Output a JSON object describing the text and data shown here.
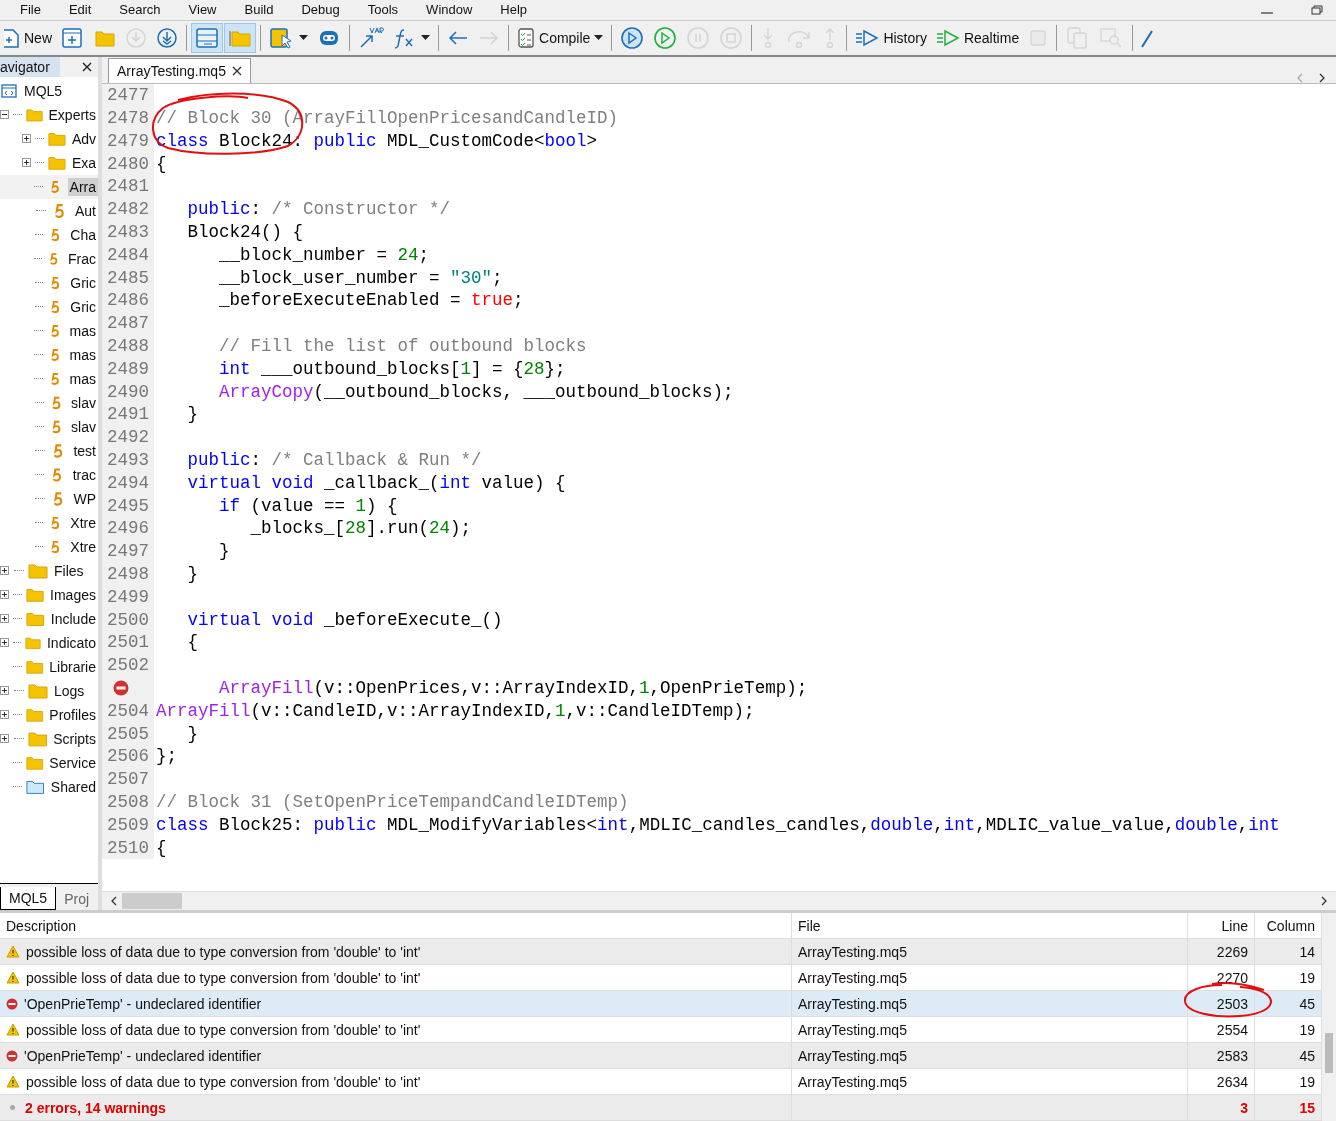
{
  "menu": [
    "File",
    "Edit",
    "Search",
    "View",
    "Build",
    "Debug",
    "Tools",
    "Window",
    "Help"
  ],
  "toolbar": [
    {
      "kind": "new",
      "label": "New",
      "disabled": false,
      "pressed": false
    },
    {
      "kind": "new-file",
      "disabled": false,
      "pressed": false
    },
    {
      "kind": "folder",
      "disabled": false,
      "pressed": false
    },
    {
      "kind": "download",
      "disabled": true,
      "pressed": false
    },
    {
      "kind": "download",
      "disabled": false,
      "pressed": false
    },
    {
      "kind": "separator"
    },
    {
      "kind": "layout",
      "disabled": false,
      "pressed": true
    },
    {
      "kind": "folder-panel",
      "disabled": false,
      "pressed": true
    },
    {
      "kind": "separator"
    },
    {
      "kind": "clipboard",
      "disabled": false,
      "pressed": false,
      "dropdown": true
    },
    {
      "kind": "robot",
      "disabled": false,
      "pressed": false
    },
    {
      "kind": "separator"
    },
    {
      "kind": "var",
      "disabled": false,
      "pressed": false
    },
    {
      "kind": "function",
      "disabled": false,
      "pressed": false,
      "dropdown": true
    },
    {
      "kind": "separator"
    },
    {
      "kind": "back",
      "disabled": false,
      "pressed": false
    },
    {
      "kind": "forward",
      "disabled": true,
      "pressed": false
    },
    {
      "kind": "separator"
    },
    {
      "kind": "compile",
      "label": "Compile",
      "disabled": false,
      "pressed": false,
      "dropdown": true
    },
    {
      "kind": "separator"
    },
    {
      "kind": "restart",
      "disabled": false,
      "pressed": false
    },
    {
      "kind": "play",
      "disabled": false,
      "pressed": false
    },
    {
      "kind": "pause",
      "disabled": true,
      "pressed": false
    },
    {
      "kind": "stop",
      "disabled": true,
      "pressed": false
    },
    {
      "kind": "separator"
    },
    {
      "kind": "step-into",
      "disabled": true,
      "pressed": false
    },
    {
      "kind": "step-over",
      "disabled": true,
      "pressed": false
    },
    {
      "kind": "step-out",
      "disabled": true,
      "pressed": false
    },
    {
      "kind": "separator"
    },
    {
      "kind": "history",
      "label": "History",
      "disabled": false,
      "pressed": false
    },
    {
      "kind": "realtime",
      "label": "Realtime",
      "disabled": false,
      "pressed": false
    },
    {
      "kind": "square",
      "disabled": true,
      "pressed": false
    },
    {
      "kind": "separator"
    },
    {
      "kind": "copy",
      "disabled": true,
      "pressed": false
    },
    {
      "kind": "search-doc",
      "disabled": true,
      "pressed": false
    },
    {
      "kind": "separator"
    },
    {
      "kind": "pen"
    }
  ],
  "navigator": {
    "title": "avigator",
    "tree": [
      {
        "label": "MQL5",
        "kind": "root",
        "selected": false,
        "children": [
          {
            "label": "Experts",
            "kind": "folder",
            "expanded": true,
            "selected": false,
            "children": [
              {
                "label": "Adv",
                "kind": "folder",
                "expanded": false,
                "selected": false
              },
              {
                "label": "Exa",
                "kind": "folder",
                "expanded": false,
                "selected": false
              },
              {
                "label": "Arra",
                "kind": "file",
                "selected": true
              },
              {
                "label": "Aut",
                "kind": "file",
                "selected": false
              },
              {
                "label": "Cha",
                "kind": "file",
                "selected": false
              },
              {
                "label": "Frac",
                "kind": "file",
                "selected": false
              },
              {
                "label": "Gric",
                "kind": "file",
                "selected": false
              },
              {
                "label": "Gric",
                "kind": "file",
                "selected": false
              },
              {
                "label": "mas",
                "kind": "file",
                "selected": false
              },
              {
                "label": "mas",
                "kind": "file",
                "selected": false
              },
              {
                "label": "mas",
                "kind": "file",
                "selected": false
              },
              {
                "label": "slav",
                "kind": "file",
                "selected": false
              },
              {
                "label": "slav",
                "kind": "file",
                "selected": false
              },
              {
                "label": "test",
                "kind": "file",
                "selected": false
              },
              {
                "label": "trac",
                "kind": "file",
                "selected": false
              },
              {
                "label": "WP",
                "kind": "file",
                "selected": false
              },
              {
                "label": "Xtre",
                "kind": "file",
                "selected": false
              },
              {
                "label": "Xtre",
                "kind": "file",
                "selected": false
              }
            ]
          },
          {
            "label": "Files",
            "kind": "folder",
            "expanded": false,
            "selected": false
          },
          {
            "label": "Images",
            "kind": "folder",
            "expanded": false,
            "selected": false
          },
          {
            "label": "Include",
            "kind": "folder",
            "expanded": false,
            "selected": false
          },
          {
            "label": "Indicato",
            "kind": "folder",
            "expanded": false,
            "selected": false
          },
          {
            "label": "Librarie",
            "kind": "folder",
            "selected": false
          },
          {
            "label": "Logs",
            "kind": "folder",
            "expanded": false,
            "selected": false
          },
          {
            "label": "Profiles",
            "kind": "folder",
            "expanded": false,
            "selected": false
          },
          {
            "label": "Scripts",
            "kind": "folder",
            "expanded": false,
            "selected": false
          },
          {
            "label": "Service",
            "kind": "folder",
            "selected": false
          },
          {
            "label": "Shared",
            "kind": "shared",
            "selected": false
          }
        ]
      }
    ],
    "tabs": [
      {
        "label": "MQL5",
        "selected": true
      },
      {
        "label": "Proj",
        "selected": false
      }
    ]
  },
  "editor": {
    "tab": "ArrayTesting.mq5",
    "lines": [
      {
        "kind": "code",
        "number": "2477"
      },
      {
        "number": "2478",
        "tokens": [
          {
            "kind": "comment",
            "text": "// Block 30 (ArrayFillOpenPricesandCandleID)"
          }
        ]
      },
      {
        "number": "2479",
        "tokens": [
          {
            "kind": "keyword",
            "text": "class"
          },
          {
            "kind": "plain",
            "text": " Block24: "
          },
          {
            "kind": "keyword",
            "text": "public"
          },
          {
            "kind": "plain",
            "text": " MDL_CustomCode<"
          },
          {
            "kind": "keyword",
            "text": "bool"
          },
          {
            "kind": "plain",
            "text": ">"
          }
        ]
      },
      {
        "number": "2480",
        "tokens": [
          {
            "kind": "plain",
            "text": "{"
          }
        ]
      },
      {
        "kind": "code",
        "number": "2481"
      },
      {
        "number": "2482",
        "tokens": [
          {
            "kind": "keyword",
            "text": "   public"
          },
          {
            "kind": "plain",
            "text": ": "
          },
          {
            "kind": "comment",
            "text": "/* Constructor */"
          }
        ]
      },
      {
        "number": "2483",
        "tokens": [
          {
            "kind": "plain",
            "text": "   Block24() {"
          }
        ]
      },
      {
        "number": "2484",
        "tokens": [
          {
            "kind": "plain",
            "text": "      __block_number = "
          },
          {
            "kind": "number",
            "text": "24"
          },
          {
            "kind": "plain",
            "text": ";"
          }
        ]
      },
      {
        "number": "2485",
        "tokens": [
          {
            "kind": "plain",
            "text": "      __block_user_number = "
          },
          {
            "kind": "string",
            "text": "\"30\""
          },
          {
            "kind": "plain",
            "text": ";"
          }
        ]
      },
      {
        "number": "2486",
        "tokens": [
          {
            "kind": "plain",
            "text": "      _beforeExecuteEnabled = "
          },
          {
            "kind": "literal",
            "text": "true"
          },
          {
            "kind": "plain",
            "text": ";"
          }
        ]
      },
      {
        "kind": "code",
        "number": "2487"
      },
      {
        "number": "2488",
        "tokens": [
          {
            "kind": "comment",
            "text": "      // Fill the list of outbound blocks"
          }
        ]
      },
      {
        "number": "2489",
        "tokens": [
          {
            "kind": "keyword",
            "text": "      int"
          },
          {
            "kind": "plain",
            "text": " ___outbound_blocks["
          },
          {
            "kind": "number",
            "text": "1"
          },
          {
            "kind": "plain",
            "text": "] = {"
          },
          {
            "kind": "number",
            "text": "28"
          },
          {
            "kind": "plain",
            "text": "};"
          }
        ]
      },
      {
        "number": "2490",
        "tokens": [
          {
            "kind": "function",
            "text": "      ArrayCopy"
          },
          {
            "kind": "plain",
            "text": "(__outbound_blocks, ___outbound_blocks);"
          }
        ]
      },
      {
        "number": "2491",
        "tokens": [
          {
            "kind": "plain",
            "text": "   }"
          }
        ]
      },
      {
        "kind": "code",
        "number": "2492"
      },
      {
        "number": "2493",
        "tokens": [
          {
            "kind": "keyword",
            "text": "   public"
          },
          {
            "kind": "plain",
            "text": ": "
          },
          {
            "kind": "comment",
            "text": "/* Callback & Run */"
          }
        ]
      },
      {
        "number": "2494",
        "tokens": [
          {
            "kind": "keyword",
            "text": "   virtual void"
          },
          {
            "kind": "plain",
            "text": " _callback_("
          },
          {
            "kind": "keyword",
            "text": "int"
          },
          {
            "kind": "plain",
            "text": " value) {"
          }
        ]
      },
      {
        "number": "2495",
        "tokens": [
          {
            "kind": "keyword",
            "text": "      if"
          },
          {
            "kind": "plain",
            "text": " (value == "
          },
          {
            "kind": "number",
            "text": "1"
          },
          {
            "kind": "plain",
            "text": ") {"
          }
        ]
      },
      {
        "number": "2496",
        "tokens": [
          {
            "kind": "plain",
            "text": "         _blocks_["
          },
          {
            "kind": "number",
            "text": "28"
          },
          {
            "kind": "plain",
            "text": "].run("
          },
          {
            "kind": "number",
            "text": "24"
          },
          {
            "kind": "plain",
            "text": ");"
          }
        ]
      },
      {
        "number": "2497",
        "tokens": [
          {
            "kind": "plain",
            "text": "      }"
          }
        ]
      },
      {
        "number": "2498",
        "tokens": [
          {
            "kind": "plain",
            "text": "   }"
          }
        ]
      },
      {
        "kind": "code",
        "number": "2499"
      },
      {
        "number": "2500",
        "tokens": [
          {
            "kind": "keyword",
            "text": "   virtual void"
          },
          {
            "kind": "plain",
            "text": " _beforeExecute_()"
          }
        ]
      },
      {
        "number": "2501",
        "tokens": [
          {
            "kind": "plain",
            "text": "   {"
          }
        ]
      },
      {
        "kind": "code",
        "number": "2502"
      },
      {
        "kind": "error",
        "tokens": [
          {
            "kind": "function",
            "text": "      ArrayFill"
          },
          {
            "kind": "plain",
            "text": "(v::OpenPrices,v::ArrayIndexID,"
          },
          {
            "kind": "number",
            "text": "1"
          },
          {
            "kind": "plain",
            "text": ",OpenPrieTemp);"
          }
        ]
      },
      {
        "number": "2504",
        "tokens": [
          {
            "kind": "function",
            "text": "ArrayFill"
          },
          {
            "kind": "plain",
            "text": "(v::CandleID,v::ArrayIndexID,"
          },
          {
            "kind": "number",
            "text": "1"
          },
          {
            "kind": "plain",
            "text": ",v::CandleIDTemp);"
          }
        ]
      },
      {
        "number": "2505",
        "tokens": [
          {
            "kind": "plain",
            "text": "   }"
          }
        ]
      },
      {
        "number": "2506",
        "tokens": [
          {
            "kind": "plain",
            "text": "};"
          }
        ]
      },
      {
        "kind": "code",
        "number": "2507"
      },
      {
        "number": "2508",
        "tokens": [
          {
            "kind": "comment",
            "text": "// Block 31 (SetOpenPriceTempandCandleIDTemp)"
          }
        ]
      },
      {
        "number": "2509",
        "tokens": [
          {
            "kind": "keyword",
            "text": "class"
          },
          {
            "kind": "plain",
            "text": " Block25: "
          },
          {
            "kind": "keyword",
            "text": "public"
          },
          {
            "kind": "plain",
            "text": " MDL_ModifyVariables<"
          },
          {
            "kind": "keyword",
            "text": "int"
          },
          {
            "kind": "plain",
            "text": ",MDLIC_candles_candles,"
          },
          {
            "kind": "keyword",
            "text": "double"
          },
          {
            "kind": "plain",
            "text": ","
          },
          {
            "kind": "keyword",
            "text": "int"
          },
          {
            "kind": "plain",
            "text": ",MDLIC_value_value,"
          },
          {
            "kind": "keyword",
            "text": "double"
          },
          {
            "kind": "plain",
            "text": ","
          },
          {
            "kind": "keyword",
            "text": "int"
          }
        ]
      },
      {
        "number": "2510",
        "tokens": [
          {
            "kind": "plain",
            "text": "{"
          }
        ]
      }
    ]
  },
  "errors": {
    "columns": [
      "Description",
      "File",
      "Line",
      "Column"
    ],
    "rows": [
      {
        "kind": "warning",
        "selected": false,
        "description": "possible loss of data due to type conversion from 'double' to 'int'",
        "file": "ArrayTesting.mq5",
        "line": "2269",
        "column": "14"
      },
      {
        "kind": "warning",
        "selected": false,
        "description": "possible loss of data due to type conversion from 'double' to 'int'",
        "file": "ArrayTesting.mq5",
        "line": "2270",
        "column": "19"
      },
      {
        "kind": "error",
        "selected": true,
        "description": "'OpenPrieTemp' - undeclared identifier",
        "file": "ArrayTesting.mq5",
        "line": "2503",
        "column": "45"
      },
      {
        "kind": "warning",
        "selected": false,
        "description": "possible loss of data due to type conversion from 'double' to 'int'",
        "file": "ArrayTesting.mq5",
        "line": "2554",
        "column": "19"
      },
      {
        "kind": "error",
        "selected": false,
        "description": "'OpenPrieTemp' - undeclared identifier",
        "file": "ArrayTesting.mq5",
        "line": "2583",
        "column": "45"
      },
      {
        "kind": "warning",
        "selected": false,
        "description": "possible loss of data due to type conversion from 'double' to 'int'",
        "file": "ArrayTesting.mq5",
        "line": "2634",
        "column": "19"
      }
    ],
    "summary": {
      "description": "2 errors, 14 warnings",
      "line": "3",
      "column": "15"
    }
  }
}
